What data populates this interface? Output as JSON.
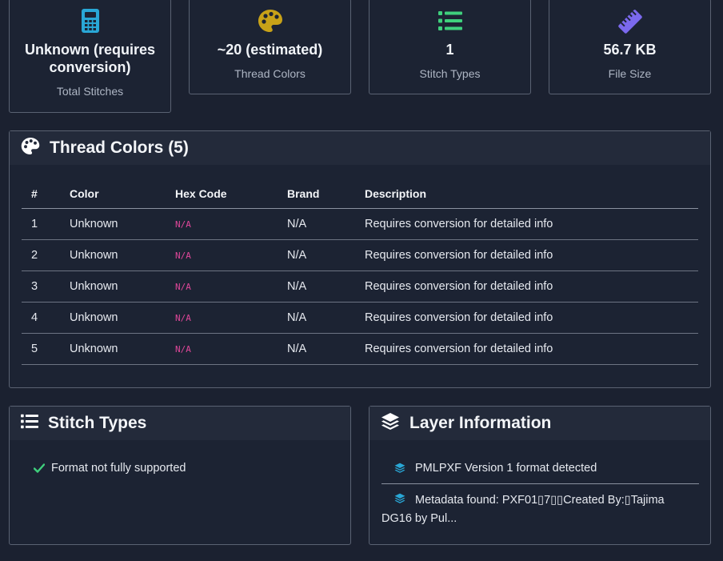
{
  "stats": [
    {
      "value": "Unknown (requires conversion)",
      "label": "Total Stitches",
      "icon": "calculator-icon",
      "color": "#29a7d6"
    },
    {
      "value": "~20 (estimated)",
      "label": "Thread Colors",
      "icon": "palette-icon",
      "color": "#c8a218"
    },
    {
      "value": "1",
      "label": "Stitch Types",
      "icon": "list-icon",
      "color": "#3fd07d"
    },
    {
      "value": "56.7 KB",
      "label": "File Size",
      "icon": "ruler-icon",
      "color": "#7b69ee"
    }
  ],
  "thread_colors": {
    "title": "Thread Colors (5)",
    "columns": [
      "#",
      "Color",
      "Hex Code",
      "Brand",
      "Description"
    ],
    "rows": [
      [
        "1",
        "Unknown",
        "N/A",
        "N/A",
        "Requires conversion for detailed info"
      ],
      [
        "2",
        "Unknown",
        "N/A",
        "N/A",
        "Requires conversion for detailed info"
      ],
      [
        "3",
        "Unknown",
        "N/A",
        "N/A",
        "Requires conversion for detailed info"
      ],
      [
        "4",
        "Unknown",
        "N/A",
        "N/A",
        "Requires conversion for detailed info"
      ],
      [
        "5",
        "Unknown",
        "N/A",
        "N/A",
        "Requires conversion for detailed info"
      ]
    ]
  },
  "stitch_types": {
    "title": "Stitch Types",
    "items": [
      "Format not fully supported"
    ]
  },
  "layer_info": {
    "title": "Layer Information",
    "items": [
      "PMLPXF Version 1 format detected",
      "Metadata found: PXF01▯7▯▯Created By:▯Tajima DG16 by Pul..."
    ]
  },
  "colors": {
    "check": "#3fd07d",
    "layer_icon": "#29a7d6",
    "hex_text": "#e0479a"
  }
}
